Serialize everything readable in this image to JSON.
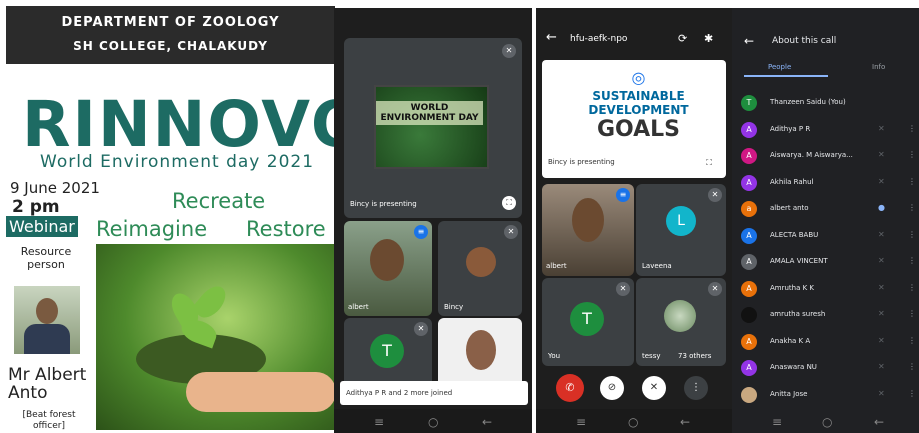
{
  "poster": {
    "department": "DEPARTMENT OF ZOOLOGY",
    "college": "SH COLLEGE, CHALAKUDY",
    "title": "RINNOVO",
    "subtitle": "World Environment day 2021",
    "date": "9 June 2021",
    "time": "2 pm",
    "webinar": "Webinar",
    "word1": "Recreate",
    "word2": "Reimagine",
    "word3": "Restore",
    "resource": "Resource person",
    "speaker": "Mr Albert Anto",
    "role": "[Beat forest officer]"
  },
  "phone1": {
    "slide_text": "WORLD ENVIRONMENT DAY",
    "presenting": "Bincy is presenting",
    "tiles": [
      "albert",
      "Bincy"
    ],
    "toast": "Adithya P R and 2 more joined"
  },
  "phone2": {
    "meeting_code": "hfu-aefk-npo",
    "slide_title_1": "SUSTAINABLE",
    "slide_title_2": "DEVELOPMENT",
    "slide_title_3": "GOALS",
    "presenting": "Bincy is presenting",
    "tiles": [
      "albert",
      "Laveena",
      "You",
      "tessy",
      "73 others"
    ]
  },
  "phone3": {
    "header": "About this call",
    "tab_people": "People",
    "tab_info": "Info",
    "participants": [
      {
        "initial": "T",
        "name": "Thanzeen Saidu (You)",
        "color": "#1e8e3e"
      },
      {
        "initial": "A",
        "name": "Adithya P R",
        "color": "#9334e6"
      },
      {
        "initial": "A",
        "name": "Aiswarya. M Aiswarya...",
        "color": "#d01884"
      },
      {
        "initial": "A",
        "name": "Akhila Rahul",
        "color": "#9334e6"
      },
      {
        "initial": "a",
        "name": "albert anto",
        "color": "#e8710a"
      },
      {
        "initial": "A",
        "name": "ALECTA BABU",
        "color": "#1a73e8"
      },
      {
        "initial": "A",
        "name": "AMALA VINCENT",
        "color": "#5f6368"
      },
      {
        "initial": "A",
        "name": "Amrutha K K",
        "color": "#e8710a"
      },
      {
        "initial": "",
        "name": "amrutha suresh",
        "color": "#111111"
      },
      {
        "initial": "A",
        "name": "Anakha K A",
        "color": "#e8710a"
      },
      {
        "initial": "A",
        "name": "Anaswara NU",
        "color": "#9334e6"
      },
      {
        "initial": "",
        "name": "Anitta Jose",
        "color": "#c9a880"
      }
    ]
  }
}
